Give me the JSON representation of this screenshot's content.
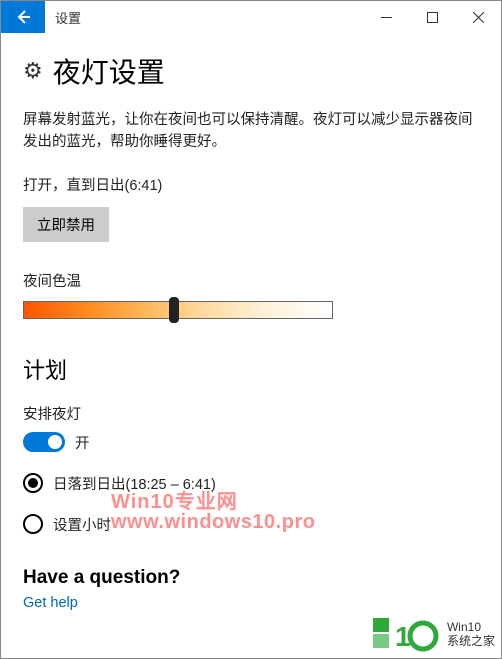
{
  "titlebar": {
    "title": "设置"
  },
  "page": {
    "title": "夜灯设置",
    "description": "屏幕发射蓝光，让你在夜间也可以保持清醒。夜灯可以减少显示器夜间发出的蓝光，帮助你睡得更好。",
    "status": "打开，直到日出(6:41)",
    "disable_btn": "立即禁用",
    "color_temp_label": "夜间色温",
    "slider_value_pct": 47
  },
  "schedule": {
    "heading": "计划",
    "toggle_label": "安排夜灯",
    "toggle_state": "开",
    "toggle_on": true,
    "options": [
      {
        "label": "日落到日出(18:25 – 6:41)",
        "selected": true
      },
      {
        "label": "设置小时",
        "selected": false
      }
    ]
  },
  "help": {
    "heading": "Have a question?",
    "link": "Get help"
  },
  "watermark": {
    "line1": "Win10专业网",
    "line2": "www.windows10.pro",
    "brand_top": "Win10",
    "brand_bottom": "系统之家"
  }
}
